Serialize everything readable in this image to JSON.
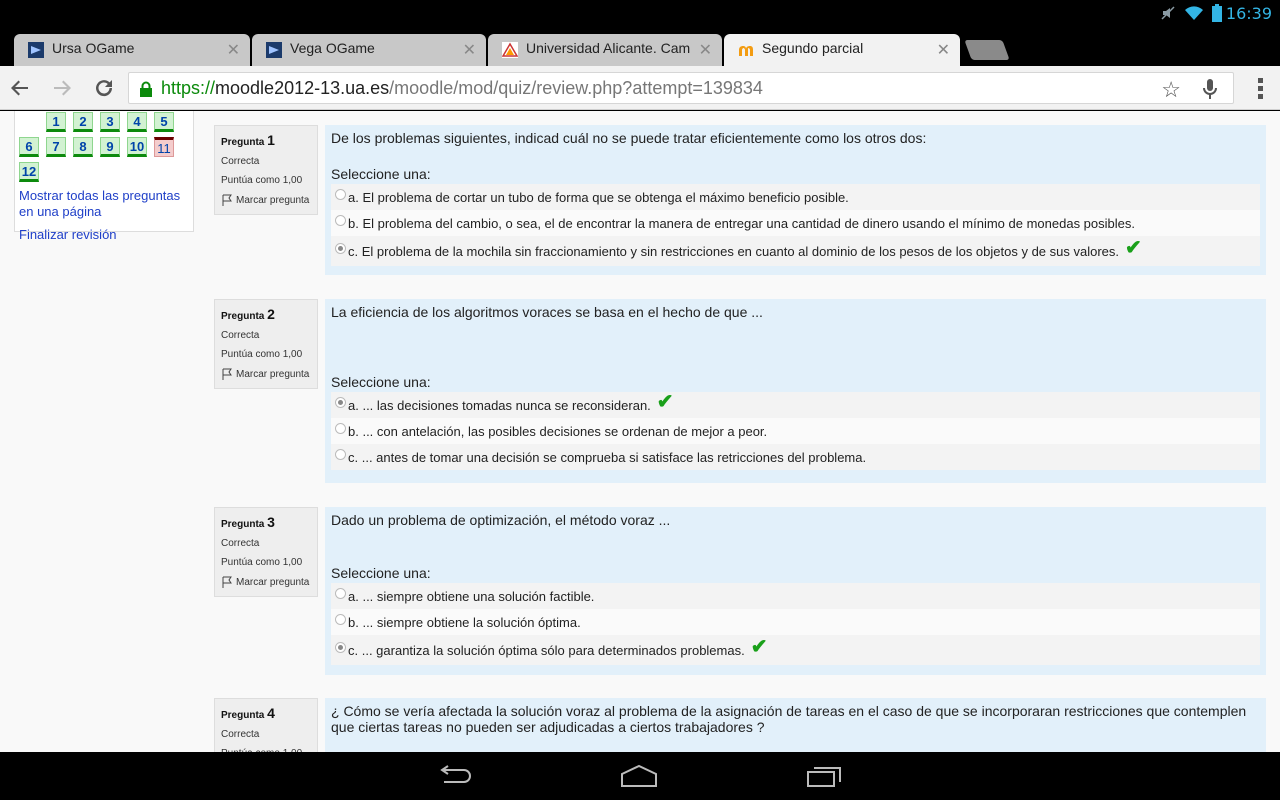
{
  "statusbar": {
    "clock": "16:39"
  },
  "tabs": [
    {
      "title": "Ursa OGame",
      "icon": "ogame-favicon-icon",
      "active": false
    },
    {
      "title": "Vega OGame",
      "icon": "ogame-favicon-icon",
      "active": false
    },
    {
      "title": "Universidad Alicante. Cam",
      "icon": "ua-favicon-icon",
      "active": false
    },
    {
      "title": "Segundo parcial",
      "icon": "moodle-favicon-icon",
      "active": true
    }
  ],
  "omnibox": {
    "scheme": "https://",
    "host": "moodle2012-13.ua.es",
    "path": "/moodle/mod/quiz/review.php?attempt=139834"
  },
  "quiz_nav": {
    "buttons": [
      "1",
      "2",
      "3",
      "4",
      "5",
      "6",
      "7",
      "8",
      "9",
      "10",
      "11",
      "12"
    ],
    "show_all": "Mostrar todas las preguntas en una página",
    "finish": "Finalizar revisión"
  },
  "labels": {
    "pregunta": "Pregunta",
    "state": "Correcta",
    "grade": "Puntúa como 1,00",
    "flag": "Marcar pregunta",
    "prompt": "Seleccione una:"
  },
  "questions": [
    {
      "number": "1",
      "text": "De los problemas siguientes, indicad cuál no se puede tratar eficientemente como los otros dos:",
      "options": [
        "a. El problema de cortar un tubo de forma que se  obtenga el máximo beneficio posible.",
        "b. El problema del cambio, o sea, el de encontrar la manera de entregar una cantidad de dinero usando el mínimo de monedas posibles.",
        "c. El problema de la mochila sin fraccionamiento y sin restricciones en cuanto al dominio de los pesos de los objetos y de sus valores."
      ],
      "selected": 2
    },
    {
      "number": "2",
      "text": "La eficiencia de los algoritmos voraces se basa en el hecho de que ...",
      "options": [
        "a. ... las decisiones tomadas nunca se reconsideran.",
        "b. ...  con antelación, las posibles decisiones se ordenan de mejor a peor.",
        "c. ... antes de tomar una decisión se comprueba si satisface las retricciones del problema."
      ],
      "selected": 0
    },
    {
      "number": "3",
      "text": "Dado un problema de optimización, el método voraz ...",
      "options": [
        "a. ... siempre obtiene una solución factible.",
        "b. ... siempre obtiene la solución óptima.",
        "c. ... garantiza la solución óptima sólo para determinados problemas."
      ],
      "selected": 2
    },
    {
      "number": "4",
      "text": "¿ Cómo se vería afectada la solución voraz al problema de la asignación de tareas en el caso de que se incorporaran restricciones que contemplen que ciertas tareas no pueden ser adjudicadas a ciertos trabajadores ?",
      "options": [],
      "selected": -1
    }
  ],
  "colors": {
    "url_scheme": "#0b8a0b",
    "correct_check": "#1aa01a",
    "status_icons": "#33b5e5"
  }
}
